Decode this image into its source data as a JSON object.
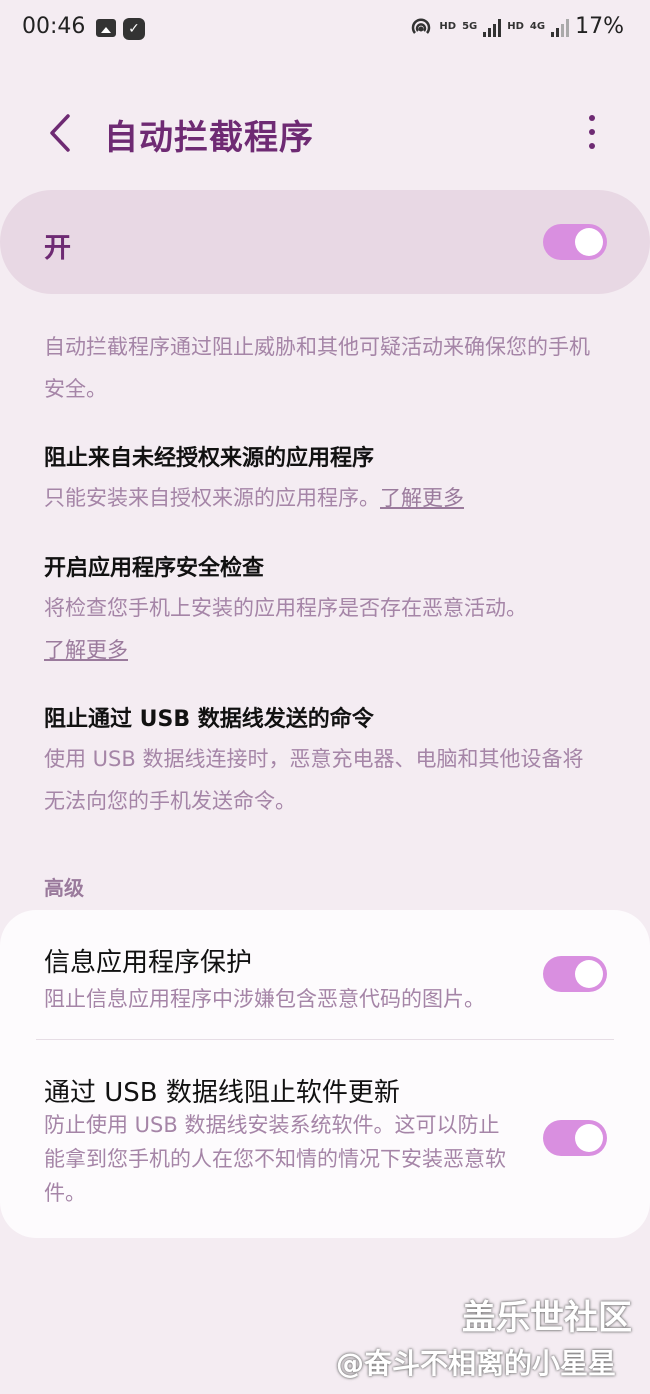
{
  "status_bar": {
    "time": "00:46",
    "hd1": "HD",
    "net1": "5G",
    "hd2": "HD",
    "net2": "4G",
    "battery": "17%"
  },
  "header": {
    "title": "自动拦截程序"
  },
  "master": {
    "label": "开",
    "enabled": true
  },
  "intro": "自动拦截程序通过阻止威胁和其他可疑活动来确保您的手机安全。",
  "items": [
    {
      "title": "阻止来自未经授权来源的应用程序",
      "desc": "只能安装来自授权来源的应用程序。",
      "link": "了解更多"
    },
    {
      "title": "开启应用程序安全检查",
      "desc": "将检查您手机上安装的应用程序是否存在恶意活动。",
      "link": "了解更多"
    },
    {
      "title": "阻止通过 USB 数据线发送的命令",
      "desc": "使用 USB 数据线连接时，恶意充电器、电脑和其他设备将无法向您的手机发送命令。"
    }
  ],
  "advanced": {
    "header": "高级",
    "options": [
      {
        "title": "信息应用程序保护",
        "desc": "阻止信息应用程序中涉嫌包含恶意代码的图片。",
        "enabled": true
      },
      {
        "title": "通过 USB 数据线阻止软件更新",
        "desc": "防止使用 USB 数据线安装系统软件。这可以防止能拿到您手机的人在您不知情的情况下安装恶意软件。",
        "enabled": true
      }
    ]
  },
  "watermark": {
    "line1": "盖乐世社区",
    "line2": "@奋斗不相离的小星星"
  },
  "colors": {
    "background": "#f4ecf2",
    "accent": "#6e2a73",
    "toggle_on": "#d98fe0"
  },
  "icons": {
    "back": "chevron-left-icon",
    "more": "more-vertical-icon"
  }
}
